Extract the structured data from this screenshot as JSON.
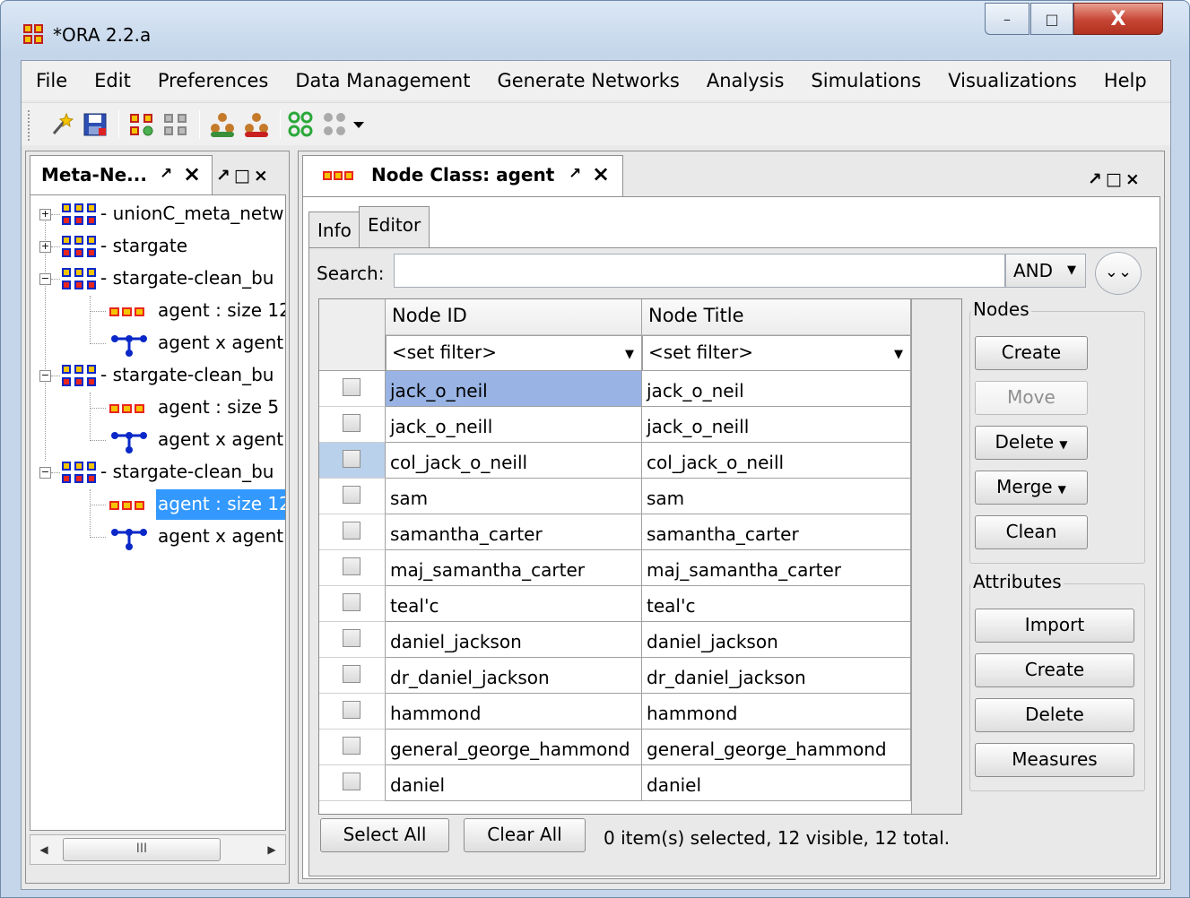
{
  "window": {
    "title": "*ORA 2.2.a",
    "controls": {
      "minimize": "–",
      "maximize": "□",
      "close": "X"
    }
  },
  "menubar": [
    "File",
    "Edit",
    "Preferences",
    "Data Management",
    "Generate Networks",
    "Analysis",
    "Simulations",
    "Visualizations",
    "Help"
  ],
  "toolbar": {
    "icons": [
      "wand-icon",
      "save-icon",
      "network-yellow-icon",
      "network-gray-icon",
      "people-green-icon",
      "people-red-icon",
      "graph-blue-icon",
      "graph-gray-icon",
      "dropdown-arrow-icon"
    ]
  },
  "left_panel": {
    "tab_label": "Meta-Ne...",
    "tree": [
      {
        "label": "- unionC_meta_netw",
        "type": "meta-network",
        "expander": "+"
      },
      {
        "label": "- stargate",
        "type": "meta-network",
        "expander": "+"
      },
      {
        "label": "- stargate-clean_bu",
        "type": "meta-network",
        "expander": "−"
      },
      {
        "label": "agent : size 12",
        "type": "node-class"
      },
      {
        "label": "agent x agent",
        "type": "network"
      },
      {
        "label": "- stargate-clean_bu",
        "type": "meta-network",
        "expander": "−"
      },
      {
        "label": "agent : size 5",
        "type": "node-class"
      },
      {
        "label": "agent x agent",
        "type": "network"
      },
      {
        "label": "- stargate-clean_bu",
        "type": "meta-network",
        "expander": "−"
      },
      {
        "label": "agent : size 12",
        "type": "node-class",
        "selected": true
      },
      {
        "label": "agent x agent",
        "type": "network"
      }
    ],
    "scroll_thumb": "III"
  },
  "right_panel": {
    "tab_label": "Node Class: agent",
    "subtabs": [
      "Info",
      "Editor"
    ],
    "active_subtab": "Editor",
    "search": {
      "label": "Search:",
      "value": "",
      "operator": "AND"
    },
    "table": {
      "headers": [
        "Node ID",
        "Node Title"
      ],
      "filter_placeholder": "<set filter>",
      "rows": [
        {
          "id": "jack_o_neil",
          "title": "jack_o_neil"
        },
        {
          "id": "jack_o_neill",
          "title": "jack_o_neill"
        },
        {
          "id": "col_jack_o_neill",
          "title": "col_jack_o_neill"
        },
        {
          "id": "sam",
          "title": "sam"
        },
        {
          "id": "samantha_carter",
          "title": "samantha_carter"
        },
        {
          "id": "maj_samantha_carter",
          "title": "maj_samantha_carter"
        },
        {
          "id": "teal'c",
          "title": "teal'c"
        },
        {
          "id": "daniel_jackson",
          "title": "daniel_jackson"
        },
        {
          "id": "dr_daniel_jackson",
          "title": "dr_daniel_jackson"
        },
        {
          "id": "hammond",
          "title": "hammond"
        },
        {
          "id": "general_george_hammond",
          "title": "general_george_hammond"
        },
        {
          "id": "daniel",
          "title": "daniel"
        }
      ]
    },
    "nodes_group": {
      "label": "Nodes",
      "buttons": [
        {
          "label": "Create",
          "enabled": true,
          "dropdown": false
        },
        {
          "label": "Move",
          "enabled": false,
          "dropdown": false
        },
        {
          "label": "Delete",
          "enabled": true,
          "dropdown": true
        },
        {
          "label": "Merge",
          "enabled": true,
          "dropdown": true
        },
        {
          "label": "Clean",
          "enabled": true,
          "dropdown": false
        }
      ]
    },
    "attributes_group": {
      "label": "Attributes",
      "buttons": [
        "Import",
        "Create",
        "Delete",
        "Measures"
      ]
    },
    "footer": {
      "select_all": "Select All",
      "clear_all": "Clear All",
      "status": "0 item(s) selected, 12 visible, 12 total."
    }
  },
  "colors": {
    "selection": "#3399ff",
    "cell_highlight": "#99b4e4",
    "node_class_icon": "#e8261d",
    "network_icon": "#0a28c8"
  }
}
